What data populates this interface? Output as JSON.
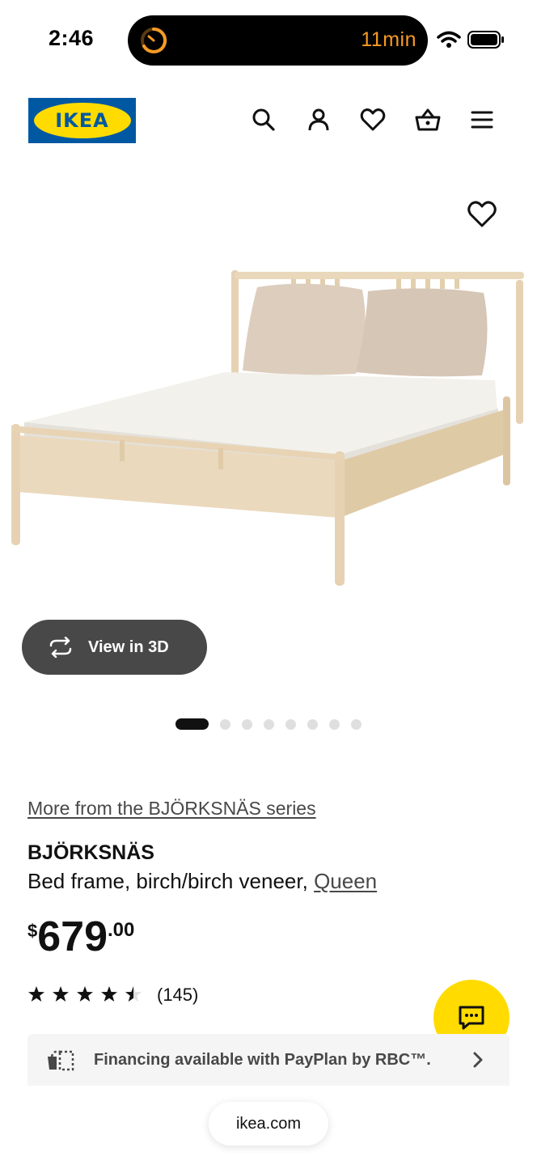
{
  "status_bar": {
    "time": "2:46",
    "timer": "11min",
    "wifi_icon": "wifi-icon",
    "battery_icon": "battery-icon"
  },
  "header": {
    "logo_text": "IKEA",
    "icons": [
      "search-icon",
      "account-icon",
      "heart-icon",
      "basket-icon",
      "menu-icon"
    ]
  },
  "gallery": {
    "favorite_icon": "heart-icon",
    "view_3d_label": "View in 3D",
    "dot_count": 8,
    "active_index": 0
  },
  "product": {
    "series_link": "More from the BJÖRKSNÄS series",
    "name": "BJÖRKSNÄS",
    "description": "Bed frame, birch/birch veneer, ",
    "size_link": "Queen",
    "price": {
      "currency": "$",
      "integer": "679",
      "decimal": ".00"
    },
    "rating": 4.5,
    "review_count": "(145)"
  },
  "financing": {
    "text": "Financing available with PayPlan by RBC™."
  },
  "browser": {
    "url": "ikea.com"
  },
  "colors": {
    "ikea_blue": "#0058a3",
    "ikea_yellow": "#ffdb00",
    "dark_pill": "#484848"
  }
}
